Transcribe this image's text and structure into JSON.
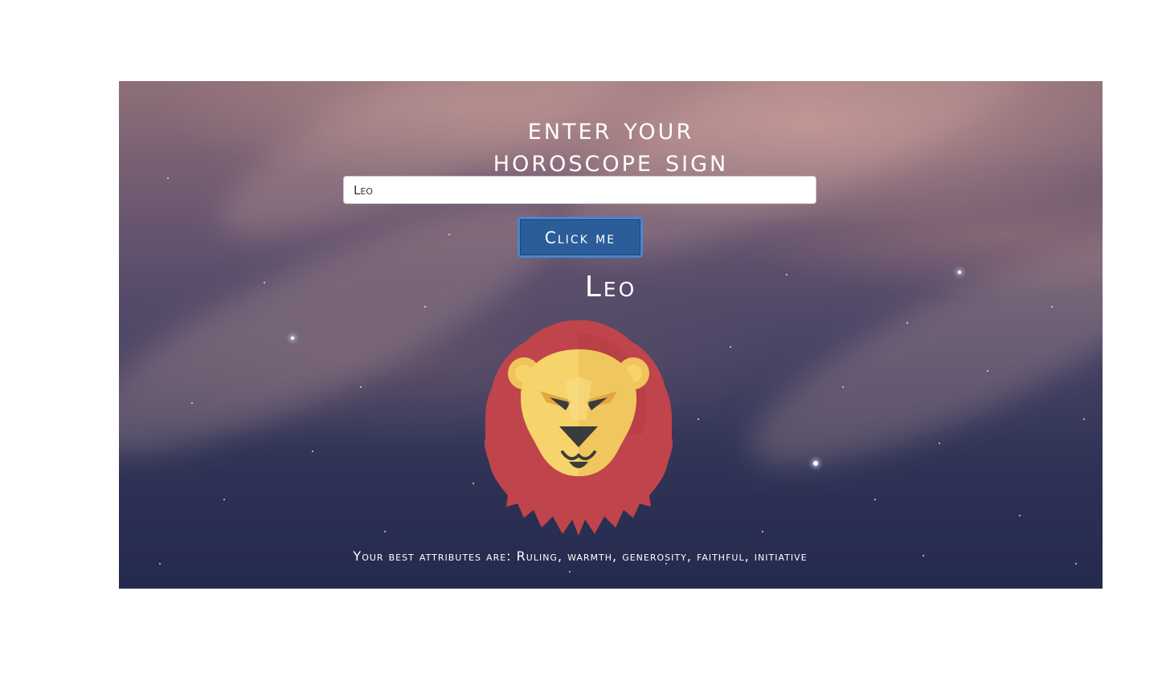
{
  "header": {
    "title_line1": "Enter your",
    "title_line2": "Horoscope Sign"
  },
  "form": {
    "input_value": "Leo",
    "button_label": "Click me"
  },
  "result": {
    "sign": "Leo",
    "icon": "lion-icon",
    "attributes_text": "Your best attributes are: Ruling, warmth, generosity, faithful, initiative"
  },
  "colors": {
    "button": "#2b5d9b",
    "button_border": "#4a86d1",
    "mane": "#c0444b",
    "face": "#f6d46b"
  }
}
